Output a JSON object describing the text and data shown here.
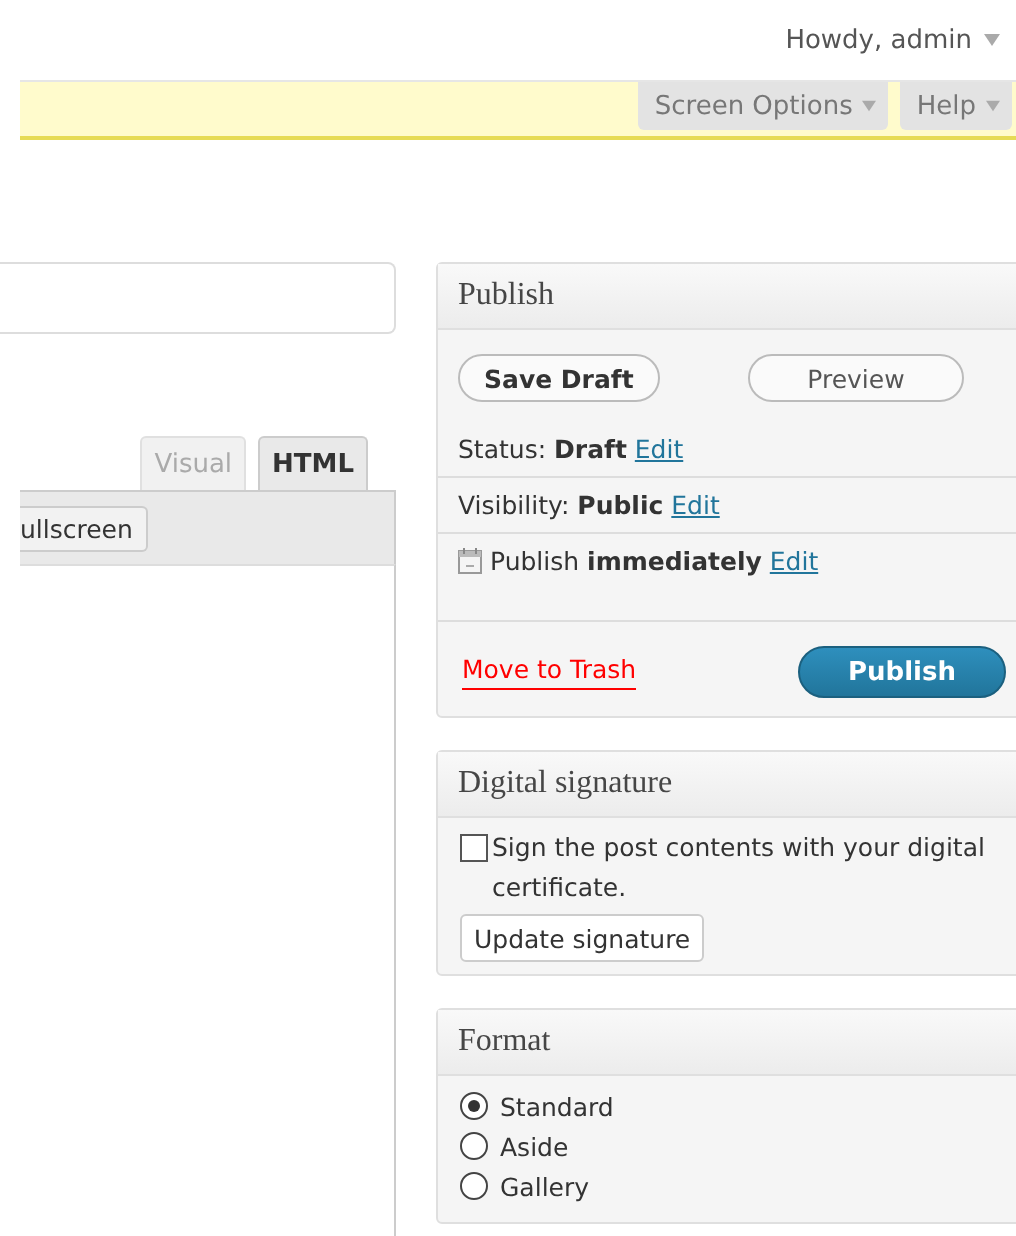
{
  "header": {
    "greeting": "Howdy, admin"
  },
  "screen_meta": {
    "tabs": [
      {
        "label": "Screen Options"
      },
      {
        "label": "Help"
      }
    ]
  },
  "editor": {
    "tabs": [
      {
        "label": "Visual",
        "selected": false
      },
      {
        "label": "HTML",
        "selected": true
      }
    ],
    "toolbar_buttons": [
      "ullscreen"
    ]
  },
  "publish": {
    "title": "Publish",
    "save_draft": "Save Draft",
    "preview": "Preview",
    "rows": [
      {
        "kind": "status",
        "label": "Status:",
        "value": "Draft",
        "link": "Edit"
      },
      {
        "kind": "visibility",
        "label": "Visibility:",
        "value": "Public",
        "link": "Edit"
      },
      {
        "kind": "schedule",
        "label": "Publish",
        "value": "immediately",
        "link": "Edit"
      }
    ],
    "trash": "Move to Trash",
    "publish": "Publish"
  },
  "signature": {
    "title": "Digital signature",
    "checked": false,
    "text": "Sign the post contents with your digital certificate.",
    "button": "Update signature"
  },
  "format": {
    "title": "Format",
    "options": [
      {
        "label": "Standard",
        "selected": true
      },
      {
        "label": "Aside",
        "selected": false
      },
      {
        "label": "Gallery",
        "selected": false
      }
    ]
  }
}
